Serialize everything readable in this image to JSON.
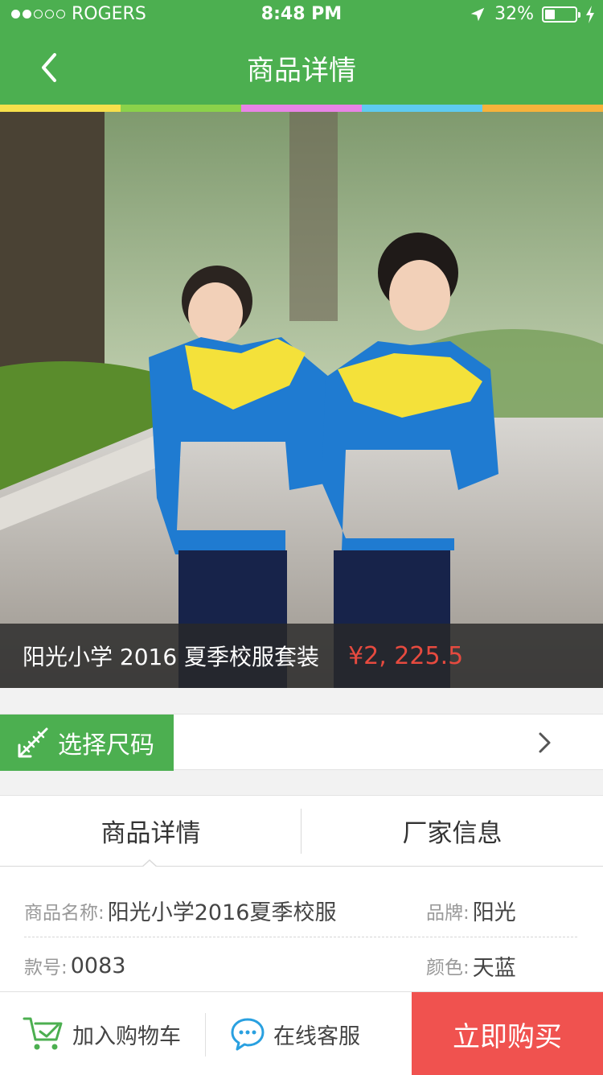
{
  "status_bar": {
    "carrier": "ROGERS",
    "time": "8:48 PM",
    "battery": "32%",
    "battery_level": 0.32,
    "signal_bars_filled": 2,
    "signal_bars_total": 5
  },
  "nav": {
    "title": "商品详情",
    "back_icon": "chevron-left-icon"
  },
  "accent_stripe": [
    "#f7e04b",
    "#8bd24a",
    "#e884e6",
    "#5ecbf0",
    "#f7b33b"
  ],
  "product": {
    "name": "阳光小学 2016 夏季校服套装",
    "price": "¥2, 225.5"
  },
  "size_selector": {
    "label": "选择尺码",
    "icon": "ruler-pencil-icon"
  },
  "tabs": [
    {
      "label": "商品详情",
      "active": true
    },
    {
      "label": "厂家信息",
      "active": false
    }
  ],
  "details": {
    "name_label": "商品名称:",
    "name_value": "阳光小学2016夏季校服",
    "brand_label": "品牌:",
    "brand_value": "阳光",
    "model_label": "款号:",
    "model_value": "0083",
    "color_label": "颜色:",
    "color_value": "天蓝"
  },
  "bottom_bar": {
    "cart_label": "加入购物车",
    "service_label": "在线客服",
    "buy_label": "立即购买"
  },
  "colors": {
    "primary_green": "#4caf50",
    "price_red": "#e64a3f",
    "buy_red": "#f0524f"
  }
}
